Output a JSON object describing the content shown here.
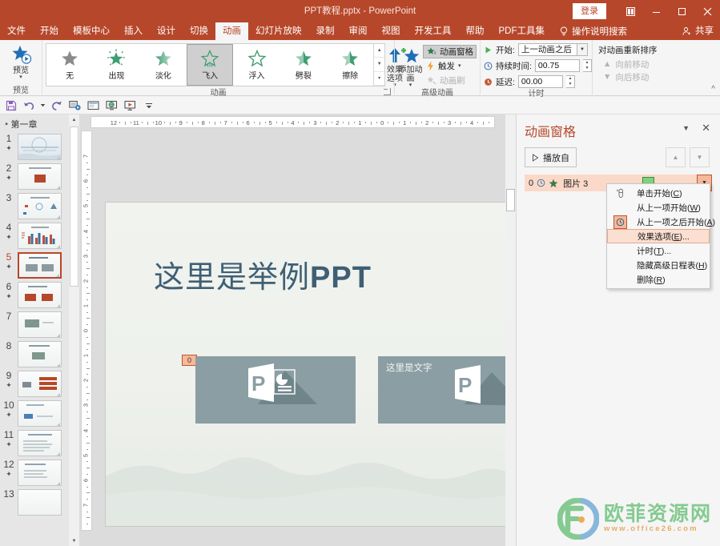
{
  "titlebar": {
    "document_title": "PPT教程.pptx",
    "separator": "-",
    "app_name": "PowerPoint",
    "signin_label": "登录",
    "ribbon_display_icon": "ribbon-display-options-icon",
    "minimize_icon": "minimize-icon",
    "maximize_icon": "maximize-icon",
    "close_icon": "close-icon"
  },
  "tabs": [
    {
      "label": "文件",
      "active": false
    },
    {
      "label": "开始",
      "active": false
    },
    {
      "label": "模板中心",
      "active": false
    },
    {
      "label": "插入",
      "active": false
    },
    {
      "label": "设计",
      "active": false
    },
    {
      "label": "切换",
      "active": false
    },
    {
      "label": "动画",
      "active": true
    },
    {
      "label": "幻灯片放映",
      "active": false
    },
    {
      "label": "录制",
      "active": false
    },
    {
      "label": "审阅",
      "active": false
    },
    {
      "label": "视图",
      "active": false
    },
    {
      "label": "开发工具",
      "active": false
    },
    {
      "label": "帮助",
      "active": false
    },
    {
      "label": "PDF工具集",
      "active": false
    }
  ],
  "tellme": {
    "label": "操作说明搜索",
    "icon": "lightbulb-icon"
  },
  "share": {
    "label": "共享",
    "icon": "share-person-icon"
  },
  "ribbon": {
    "groups": [
      {
        "name": "预览",
        "label": "预览"
      },
      {
        "name": "动画",
        "label": "动画"
      },
      {
        "name": "高级动画",
        "label": "高级动画"
      },
      {
        "name": "计时",
        "label": "计时"
      },
      {
        "name": "重新排序",
        "label": ""
      }
    ],
    "preview": {
      "button_label": "预览",
      "icon": "preview-star-icon"
    },
    "gallery": [
      {
        "label": "无",
        "icon": "none-star-icon",
        "selected": false
      },
      {
        "label": "出现",
        "icon": "appear-star-icon",
        "selected": false
      },
      {
        "label": "淡化",
        "icon": "fade-star-icon",
        "selected": false
      },
      {
        "label": "飞入",
        "icon": "fly-in-star-icon",
        "selected": true
      },
      {
        "label": "浮入",
        "icon": "float-in-star-icon",
        "selected": false
      },
      {
        "label": "劈裂",
        "icon": "split-star-icon",
        "selected": false
      },
      {
        "label": "擦除",
        "icon": "wipe-star-icon",
        "selected": false
      }
    ],
    "effect_options": {
      "label": "效果选项",
      "icon": "up-arrow-icon"
    },
    "advanced": {
      "add_animation": {
        "label": "添加动画",
        "icon": "add-animation-star-icon"
      },
      "animation_pane": {
        "label": "动画窗格",
        "icon": "animation-pane-icon",
        "toggled": true
      },
      "trigger": {
        "label": "触发",
        "icon": "trigger-lightning-icon"
      },
      "animation_painter": {
        "label": "动画刷",
        "icon": "animation-painter-icon",
        "disabled": true
      }
    },
    "timing": {
      "start_label": "开始:",
      "start_value": "上一动画之后",
      "start_icon": "play-triangle-icon",
      "duration_label": "持续时间:",
      "duration_value": "00.75",
      "duration_icon": "clock-icon",
      "delay_label": "延迟:",
      "delay_value": "00.00",
      "delay_icon": "delay-clock-icon",
      "reorder_title": "对动画重新排序",
      "move_earlier": "向前移动",
      "move_later": "向后移动"
    }
  },
  "quick_access": [
    {
      "name": "save-icon"
    },
    {
      "name": "undo-icon"
    },
    {
      "name": "undo-dropdown-icon"
    },
    {
      "name": "redo-icon"
    },
    {
      "name": "start-from-beginning-icon"
    },
    {
      "name": "new-slide-icon"
    },
    {
      "name": "present-online-icon"
    },
    {
      "name": "slideshow-icon"
    },
    {
      "name": "customize-qat-icon"
    }
  ],
  "thumbnails": {
    "section_title": "第一章",
    "slides": [
      {
        "number": "1",
        "has_star": true,
        "active": false,
        "kind": "cover"
      },
      {
        "number": "2",
        "has_star": true,
        "active": false,
        "kind": "one-red"
      },
      {
        "number": "3",
        "has_star": false,
        "active": false,
        "kind": "icons"
      },
      {
        "number": "4",
        "has_star": true,
        "active": false,
        "kind": "chart"
      },
      {
        "number": "5",
        "has_star": true,
        "active": true,
        "kind": "two-gray"
      },
      {
        "number": "6",
        "has_star": true,
        "active": false,
        "kind": "two-red"
      },
      {
        "number": "7",
        "has_star": false,
        "active": false,
        "kind": "one-green"
      },
      {
        "number": "8",
        "has_star": false,
        "active": false,
        "kind": "one-green-title"
      },
      {
        "number": "9",
        "has_star": true,
        "active": false,
        "kind": "grid-red"
      },
      {
        "number": "10",
        "has_star": true,
        "active": false,
        "kind": "one-blue"
      },
      {
        "number": "11",
        "has_star": true,
        "active": false,
        "kind": "text-page"
      },
      {
        "number": "12",
        "has_star": true,
        "active": false,
        "kind": "list-page"
      },
      {
        "number": "13",
        "has_star": false,
        "active": false,
        "kind": "partial"
      }
    ]
  },
  "rulers": {
    "horizontal": [
      "12",
      "11",
      "10",
      "9",
      "8",
      "7",
      "6",
      "5",
      "4",
      "3",
      "2",
      "1",
      "0",
      "1",
      "2",
      "3",
      "4"
    ],
    "vertical": [
      "7",
      "6",
      "5",
      "4",
      "3",
      "2",
      "1",
      "0",
      "1",
      "2",
      "3",
      "4",
      "5",
      "6",
      "7"
    ]
  },
  "slide": {
    "title_cn": "这里是举例",
    "title_en": "PPT",
    "card_text": "这里是文字",
    "animation_badge": "0"
  },
  "animation_pane": {
    "title": "动画窗格",
    "collapse_icon": "chevron-down-icon",
    "close_icon": "close-icon",
    "play_button": "播放自",
    "play_icon": "play-triangle-icon",
    "move_up_icon": "move-up-arrow-icon",
    "move_down_icon": "move-down-arrow-icon",
    "item": {
      "index": "0",
      "clock_icon": "after-previous-clock-icon",
      "effect_icon": "entrance-star-icon",
      "label": "图片 3",
      "dropdown_icon": "chevron-down-icon"
    }
  },
  "context_menu": [
    {
      "label_prefix": "单击开始(",
      "key": "C",
      "label_suffix": ")",
      "icon": "mouse-click-icon",
      "highlight": false,
      "boxed": false
    },
    {
      "label_prefix": "从上一项开始(",
      "key": "W",
      "label_suffix": ")",
      "icon": "",
      "highlight": false,
      "boxed": false
    },
    {
      "label_prefix": "从上一项之后开始(",
      "key": "A",
      "label_suffix": ")",
      "icon": "clock-icon",
      "highlight": false,
      "boxed": true
    },
    {
      "label_prefix": "效果选项(",
      "key": "E",
      "label_suffix": ")...",
      "icon": "",
      "highlight": true,
      "boxed": false
    },
    {
      "label_prefix": "计时(",
      "key": "T",
      "label_suffix": ")...",
      "icon": "",
      "highlight": false,
      "boxed": false
    },
    {
      "label_prefix": "隐藏高级日程表(",
      "key": "H",
      "label_suffix": ")",
      "icon": "",
      "highlight": false,
      "boxed": false
    },
    {
      "label_prefix": "删除(",
      "key": "R",
      "label_suffix": ")",
      "icon": "",
      "highlight": false,
      "boxed": false
    }
  ],
  "watermark": {
    "brand": "欧菲资源网",
    "url": "www.office26.com",
    "logo_icon": "f-circle-logo-icon"
  },
  "colors": {
    "accent": "#b7472a",
    "pane_highlight": "#fbd9c9",
    "badge_border": "#c0562f",
    "green_bar": "#7fd17f",
    "slide_title": "#3f5f74",
    "card": "#8b9ea3"
  }
}
